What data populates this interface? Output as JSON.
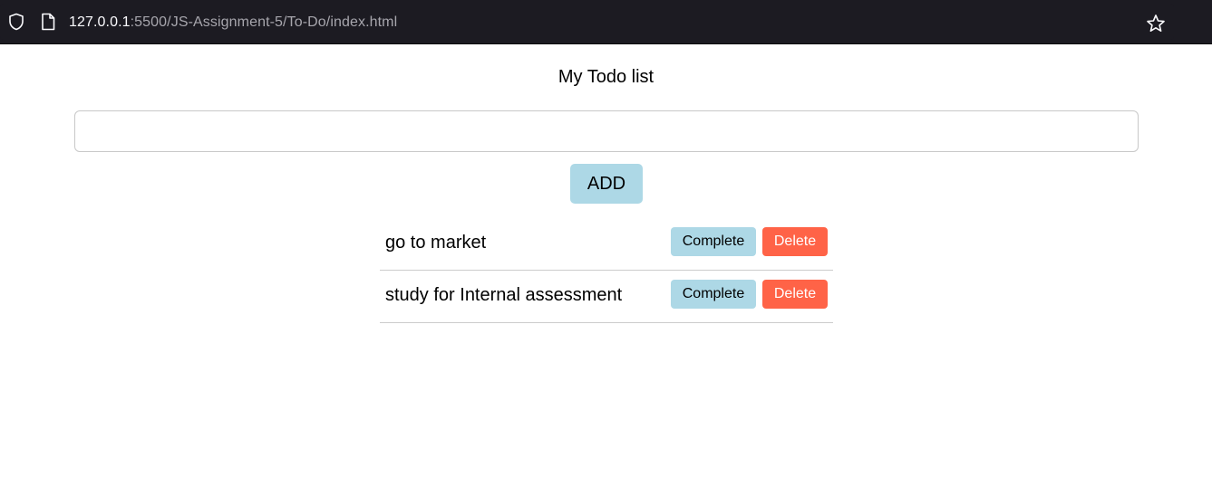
{
  "browser": {
    "url_host": "127.0.0.1",
    "url_path": ":5500/JS-Assignment-5/To-Do/index.html",
    "icons": [
      "shield-icon",
      "page-icon",
      "star-icon"
    ]
  },
  "app": {
    "title": "My Todo list",
    "input": {
      "value": "",
      "placeholder": ""
    },
    "add_label": "ADD",
    "complete_label": "Complete",
    "delete_label": "Delete",
    "todos": [
      {
        "text": "go to market"
      },
      {
        "text": "study for Internal assessment"
      }
    ]
  },
  "colors": {
    "add_button": "#add8e6",
    "complete_button": "#add8e6",
    "delete_button": "#ff6347",
    "browser_bar": "#1c1b22"
  }
}
